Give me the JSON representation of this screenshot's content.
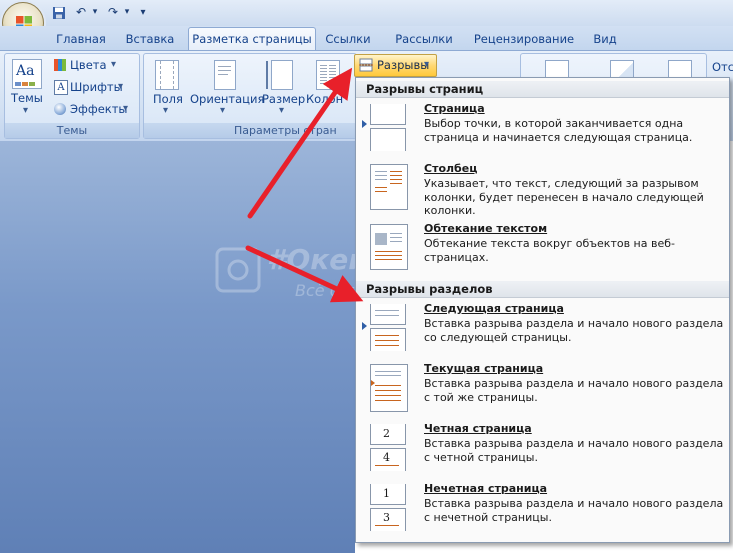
{
  "quick_access": {
    "save": "💾",
    "undo": "↶",
    "redo": "↷",
    "customize": "▾"
  },
  "tabs": [
    "Главная",
    "Вставка",
    "Разметка страницы",
    "Ссылки",
    "Рассылки",
    "Рецензирование",
    "Вид"
  ],
  "ribbon": {
    "themes_group": {
      "label": "Темы",
      "themes_button": "Темы",
      "colors": "Цвета",
      "fonts": "Шрифты",
      "effects": "Эффекты"
    },
    "page_setup_group": {
      "label": "Параметры стран",
      "margins": "Поля",
      "orientation": "Ориентация",
      "size": "Размер",
      "columns": "Колон",
      "breaks_button": "Разрывы"
    },
    "right_partial": "Отс"
  },
  "watermark": {
    "line1": "#ОкейГик",
    "line2": "Всё о технологиях"
  },
  "menu": {
    "page_breaks_header": "Разрывы страниц",
    "section_breaks_header": "Разрывы разделов",
    "items": [
      {
        "title": "Страница",
        "desc": "Выбор точки, в которой заканчивается одна страница и начинается следующая страница.",
        "icon": "page-break-icon"
      },
      {
        "title": "Столбец",
        "desc": "Указывает, что текст, следующий за разрывом колонки, будет перенесен в начало следующей колонки.",
        "icon": "column-break-icon"
      },
      {
        "title": "Обтекание текстом",
        "desc": "Обтекание текста вокруг объектов на веб-страницах.",
        "icon": "text-wrapping-break-icon"
      },
      {
        "title": "Следующая страница",
        "desc": "Вставка разрыва раздела и начало нового раздела со следующей страницы.",
        "icon": "next-page-section-icon"
      },
      {
        "title": "Текущая страница",
        "desc": "Вставка разрыва раздела и начало нового раздела с той же страницы.",
        "icon": "continuous-section-icon"
      },
      {
        "title": "Четная страница",
        "desc": "Вставка разрыва раздела и начало нового раздела с четной страницы.",
        "icon": "even-page-section-icon"
      },
      {
        "title": "Нечетная страница",
        "desc": "Вставка разрыва раздела и начало нового раздела с нечетной страницы.",
        "icon": "odd-page-section-icon"
      }
    ],
    "even_numbers": [
      "2",
      "4"
    ],
    "odd_numbers": [
      "1",
      "3"
    ]
  },
  "colors": {
    "arrow": "#e8202a",
    "accent_line": "#c8651f"
  }
}
